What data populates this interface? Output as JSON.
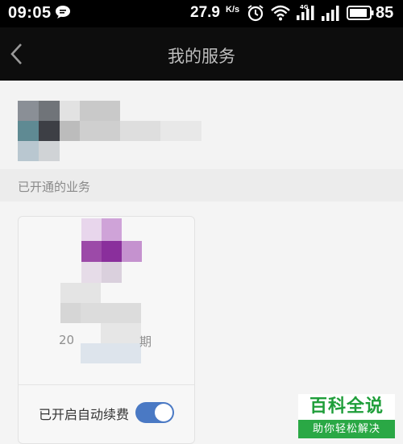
{
  "status_bar": {
    "time": "09:05",
    "speed_value": "27.9",
    "speed_unit": "K/s",
    "signal_tag": "4G",
    "battery": "85",
    "icons": [
      "chat-bubble-icon",
      "alarm-icon",
      "wifi-icon",
      "signal-4g-icon",
      "signal-icon",
      "battery-icon"
    ]
  },
  "nav": {
    "title": "我的服务",
    "back_icon": "chevron-left-icon"
  },
  "section": {
    "label": "已开通的业务"
  },
  "card": {
    "date_start": "20",
    "date_end": "期",
    "renew_label": "已开启自动续费",
    "renew_enabled": true
  },
  "watermark": {
    "title": "百科全说",
    "subtitle": "助你轻松解决"
  },
  "colors": {
    "toggle_on": "#4a79c4",
    "watermark_green": "#1f9e3a"
  }
}
